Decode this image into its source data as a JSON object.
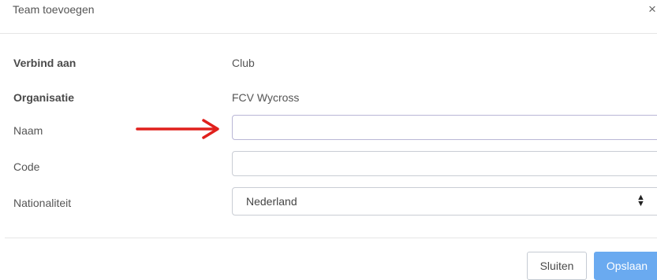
{
  "dialog": {
    "title": "Team toevoegen",
    "close_glyph": "×"
  },
  "form": {
    "verbind_label": "Verbind aan",
    "verbind_value": "Club",
    "organisatie_label": "Organisatie",
    "organisatie_value": "FCV Wycross",
    "naam_label": "Naam",
    "naam_value": "",
    "code_label": "Code",
    "code_value": "",
    "nationaliteit_label": "Nationaliteit",
    "nationaliteit_value": "Nederland"
  },
  "footer": {
    "close_label": "Sluiten",
    "save_label": "Opslaan"
  },
  "colors": {
    "annotation_arrow": "#e0201c",
    "primary_button": "#6aaaf0"
  }
}
